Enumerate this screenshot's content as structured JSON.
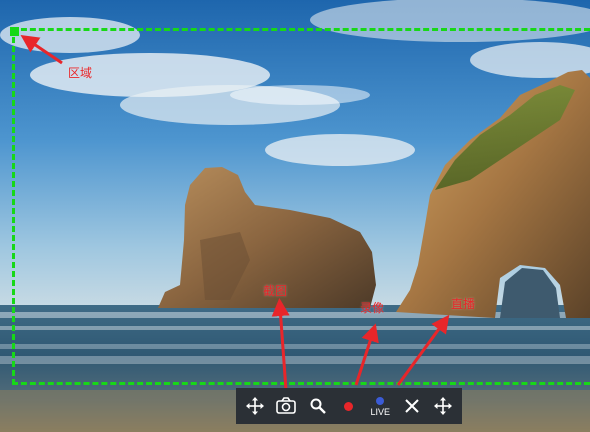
{
  "annotations": {
    "region_label": "区域",
    "screenshot_label": "截图",
    "record_label": "录像",
    "live_label": "直播"
  },
  "toolbar": {
    "move_left_icon": "move-arrows-icon",
    "camera_icon": "camera-icon",
    "search_icon": "magnifier-icon",
    "record_dot_color": "#e8262a",
    "live_text": "LIVE",
    "live_dot_color": "#3b5bd6",
    "close_icon": "close-x-icon",
    "move_right_icon": "move-arrows-icon"
  },
  "colors": {
    "region_border": "#17d817",
    "annotation_text": "#e8262a",
    "arrow": "#e8262a",
    "toolbar_bg": "#2b3036"
  }
}
